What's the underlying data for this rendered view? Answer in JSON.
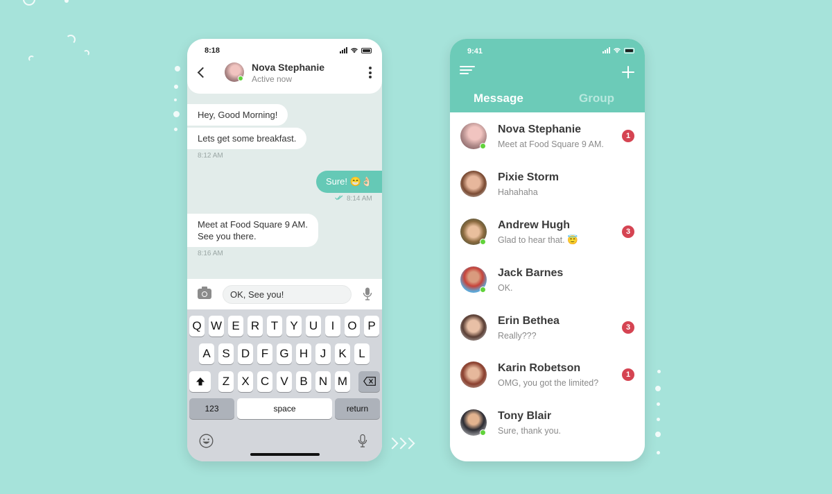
{
  "chat": {
    "status_time": "8:18",
    "contact_name": "Nova Stephanie",
    "contact_status": "Active now",
    "messages": [
      {
        "text": "Hey, Good Morning!"
      },
      {
        "text": "Lets get some breakfast."
      },
      {
        "time": "8:12 AM"
      },
      {
        "text": "Sure! 😁👌🏻"
      },
      {
        "time": "8:14 AM"
      },
      {
        "line1": "Meet at Food Square 9 AM.",
        "line2": "See you there."
      },
      {
        "time": "8:16 AM"
      }
    ],
    "input_value": "OK, See you!",
    "keyboard": {
      "row1": [
        "Q",
        "W",
        "E",
        "R",
        "T",
        "Y",
        "U",
        "I",
        "O",
        "P"
      ],
      "row2": [
        "A",
        "S",
        "D",
        "F",
        "G",
        "H",
        "J",
        "K",
        "L"
      ],
      "row3": [
        "Z",
        "X",
        "C",
        "V",
        "B",
        "N",
        "M"
      ],
      "numbers_key": "123",
      "space_key": "space",
      "return_key": "return"
    }
  },
  "messages_app": {
    "status_time": "9:41",
    "tabs": [
      "Message",
      "Group"
    ],
    "conversations": [
      {
        "name": "Nova Stephanie",
        "preview": "Meet at Food Square 9 AM.",
        "unread": "1",
        "online": true
      },
      {
        "name": "Pixie Storm",
        "preview": "Hahahaha",
        "online": false
      },
      {
        "name": "Andrew Hugh",
        "preview": "Glad to hear that. 😇",
        "unread": "3",
        "online": true
      },
      {
        "name": "Jack Barnes",
        "preview": "OK.",
        "online": true
      },
      {
        "name": "Erin Bethea",
        "preview": "Really???",
        "unread": "3",
        "online": false
      },
      {
        "name": "Karin Robetson",
        "preview": "OMG, you got the limited?",
        "unread": "1",
        "online": false
      },
      {
        "name": "Tony Blair",
        "preview": "Sure, thank you.",
        "online": true
      }
    ]
  },
  "colors": {
    "background": "#a6e3da",
    "accent": "#6ccbb8",
    "outgoing_bubble": "#65c9b6",
    "badge": "#d54452",
    "online": "#61d23b"
  }
}
